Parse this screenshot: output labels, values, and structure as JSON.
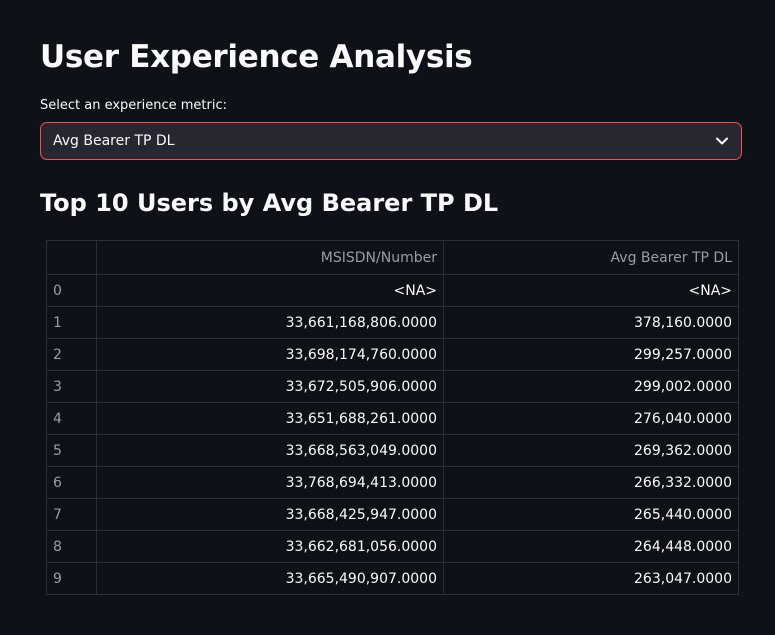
{
  "page": {
    "title": "User Experience Analysis"
  },
  "selector": {
    "label": "Select an experience metric:",
    "selected": "Avg Bearer TP DL",
    "accent_color": "#ff4b4b"
  },
  "section": {
    "title": "Top 10 Users by Avg Bearer TP DL"
  },
  "table": {
    "columns": [
      "",
      "MSISDN/Number",
      "Avg Bearer TP DL"
    ],
    "rows": [
      [
        "0",
        "<NA>",
        "<NA>"
      ],
      [
        "1",
        "33,661,168,806.0000",
        "378,160.0000"
      ],
      [
        "2",
        "33,698,174,760.0000",
        "299,257.0000"
      ],
      [
        "3",
        "33,672,505,906.0000",
        "299,002.0000"
      ],
      [
        "4",
        "33,651,688,261.0000",
        "276,040.0000"
      ],
      [
        "5",
        "33,668,563,049.0000",
        "269,362.0000"
      ],
      [
        "6",
        "33,768,694,413.0000",
        "266,332.0000"
      ],
      [
        "7",
        "33,668,425,947.0000",
        "265,440.0000"
      ],
      [
        "8",
        "33,662,681,056.0000",
        "264,448.0000"
      ],
      [
        "9",
        "33,665,490,907.0000",
        "263,047.0000"
      ]
    ]
  },
  "icons": {
    "dropdown": "chevron-down-icon"
  }
}
